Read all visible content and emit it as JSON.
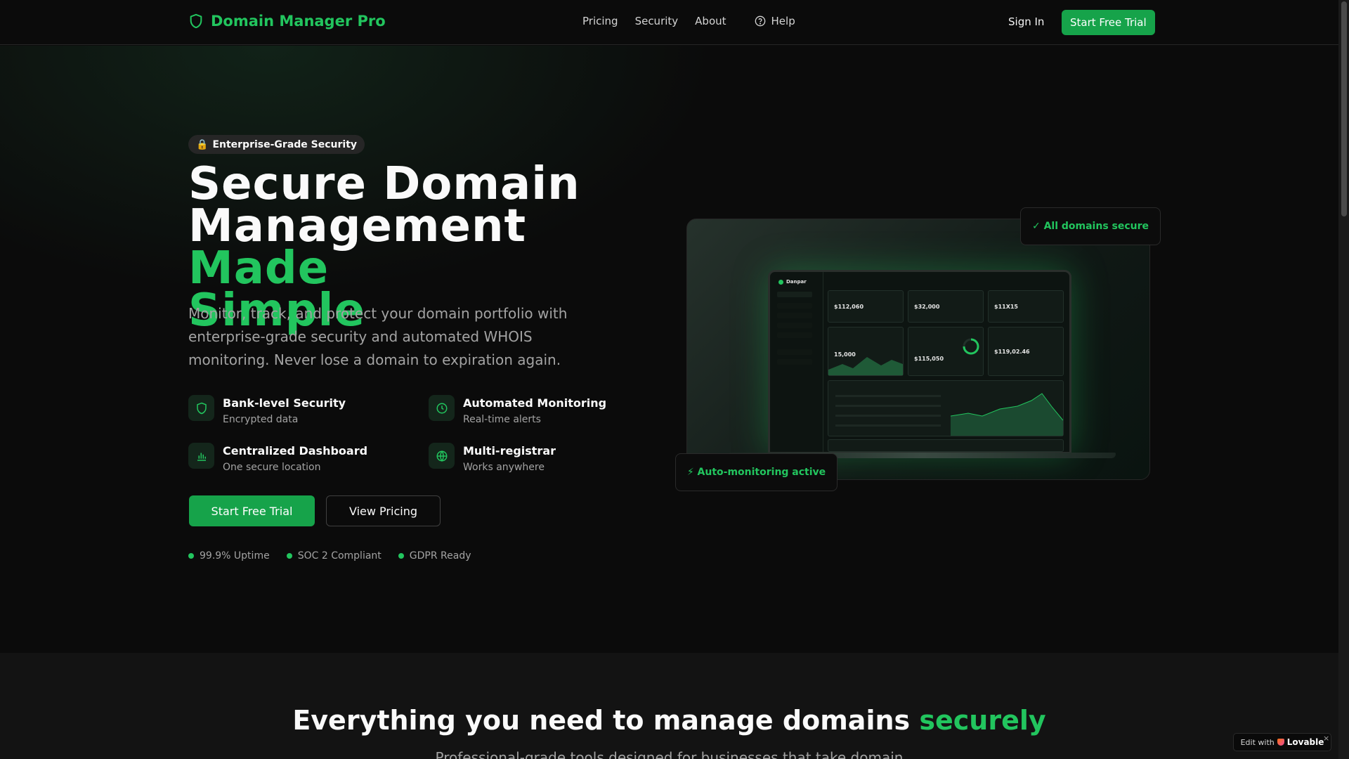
{
  "colors": {
    "accent": "#22c55e",
    "cta": "#16a34a",
    "background": "#0b0b0b"
  },
  "nav": {
    "brand": "Domain Manager Pro",
    "links": [
      "Pricing",
      "Security",
      "About"
    ],
    "help": "Help",
    "sign_in": "Sign In",
    "cta": "Start Free Trial"
  },
  "hero": {
    "badge": "Enterprise-Grade Security",
    "headline_line1": "Secure Domain",
    "headline_line2_plain": "Management ",
    "headline_line2_accent": "Made",
    "headline_line3_accent": "Simple",
    "lede": "Monitor, track, and protect your domain portfolio with enterprise-grade security and automated WHOIS monitoring. Never lose a domain to expiration again.",
    "features": [
      {
        "title": "Bank-level Security",
        "subtitle": "Encrypted data",
        "icon": "shield-icon"
      },
      {
        "title": "Automated Monitoring",
        "subtitle": "Real-time alerts",
        "icon": "clock-icon"
      },
      {
        "title": "Centralized Dashboard",
        "subtitle": "One secure location",
        "icon": "bar-chart-icon"
      },
      {
        "title": "Multi-registrar",
        "subtitle": "Works anywhere",
        "icon": "globe-icon"
      }
    ],
    "primary_button": "Start Free Trial",
    "secondary_button": "View Pricing",
    "trust": [
      "99.9% Uptime",
      "SOC 2 Compliant",
      "GDPR Ready"
    ],
    "float_secure": "✓ All domains secure",
    "float_monitor": "⚡ Auto-monitoring active"
  },
  "mockup": {
    "brand": "Danpar",
    "values": [
      "$112,060",
      "$32,000",
      "$11X15",
      "15,000",
      "$115,050",
      "$119,02.46"
    ]
  },
  "section2": {
    "title_plain": "Everything you need to manage domains ",
    "title_accent": "securely",
    "subtitle": "Professional-grade tools designed for businesses that take domain"
  },
  "lovable": {
    "prefix": "Edit with",
    "brand": "Lovable",
    "close": "×"
  }
}
